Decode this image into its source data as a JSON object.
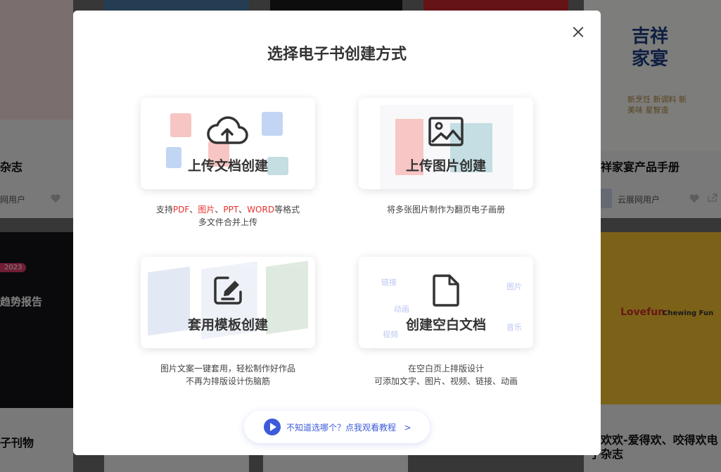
{
  "background": {
    "cards": [
      {
        "title": "杂志",
        "user": "网用户"
      },
      {
        "title": "祥家宴产品手册",
        "user": "云展网用户"
      },
      {
        "title": "子刊物",
        "user": ""
      },
      {
        "title": "苏欢欢-爱得欢、咬得欢电子杂志",
        "user": ""
      },
      {
        "brand_line1": "吉祥",
        "brand_line2": "家宴",
        "brand_sub": "新烹饪 新调料 新美味 星智造"
      },
      {
        "badge": "2023",
        "banner": "趋势报告"
      },
      {
        "brand": "Lovefun",
        "brand2": "Chewing Fun"
      }
    ]
  },
  "modal": {
    "title": "选择电子书创建方式",
    "options": [
      {
        "label": "上传文档创建",
        "icon": "cloud-upload-icon",
        "desc_parts": [
          "支持",
          "PDF",
          "、",
          "图片",
          "、",
          "PPT",
          "、",
          "WORD",
          "等格式"
        ],
        "desc_line2": "多文件合并上传"
      },
      {
        "label": "上传图片创建",
        "icon": "image-icon",
        "desc_line1": "将多张图片制作为翻页电子画册"
      },
      {
        "label": "套用模板创建",
        "icon": "edit-icon",
        "desc_line1": "图片文案一键套用，轻松制作好作品",
        "desc_line2": "不再为排版设计伤脑筋"
      },
      {
        "label": "创建空白文档",
        "icon": "blank-file-icon",
        "deco": [
          "链接",
          "动画",
          "视频",
          "图片",
          "音乐"
        ],
        "desc_line1": "在空白页上排版设计",
        "desc_line2": "可添加文字、图片、视频、链接、动画"
      }
    ],
    "help_text": "不知道选哪个？点我观看教程",
    "help_arrow": ">"
  },
  "colors": {
    "accent": "#3d5bd8",
    "highlight": "#e5322d",
    "overlay": "rgba(0,0,0,0.5)"
  }
}
